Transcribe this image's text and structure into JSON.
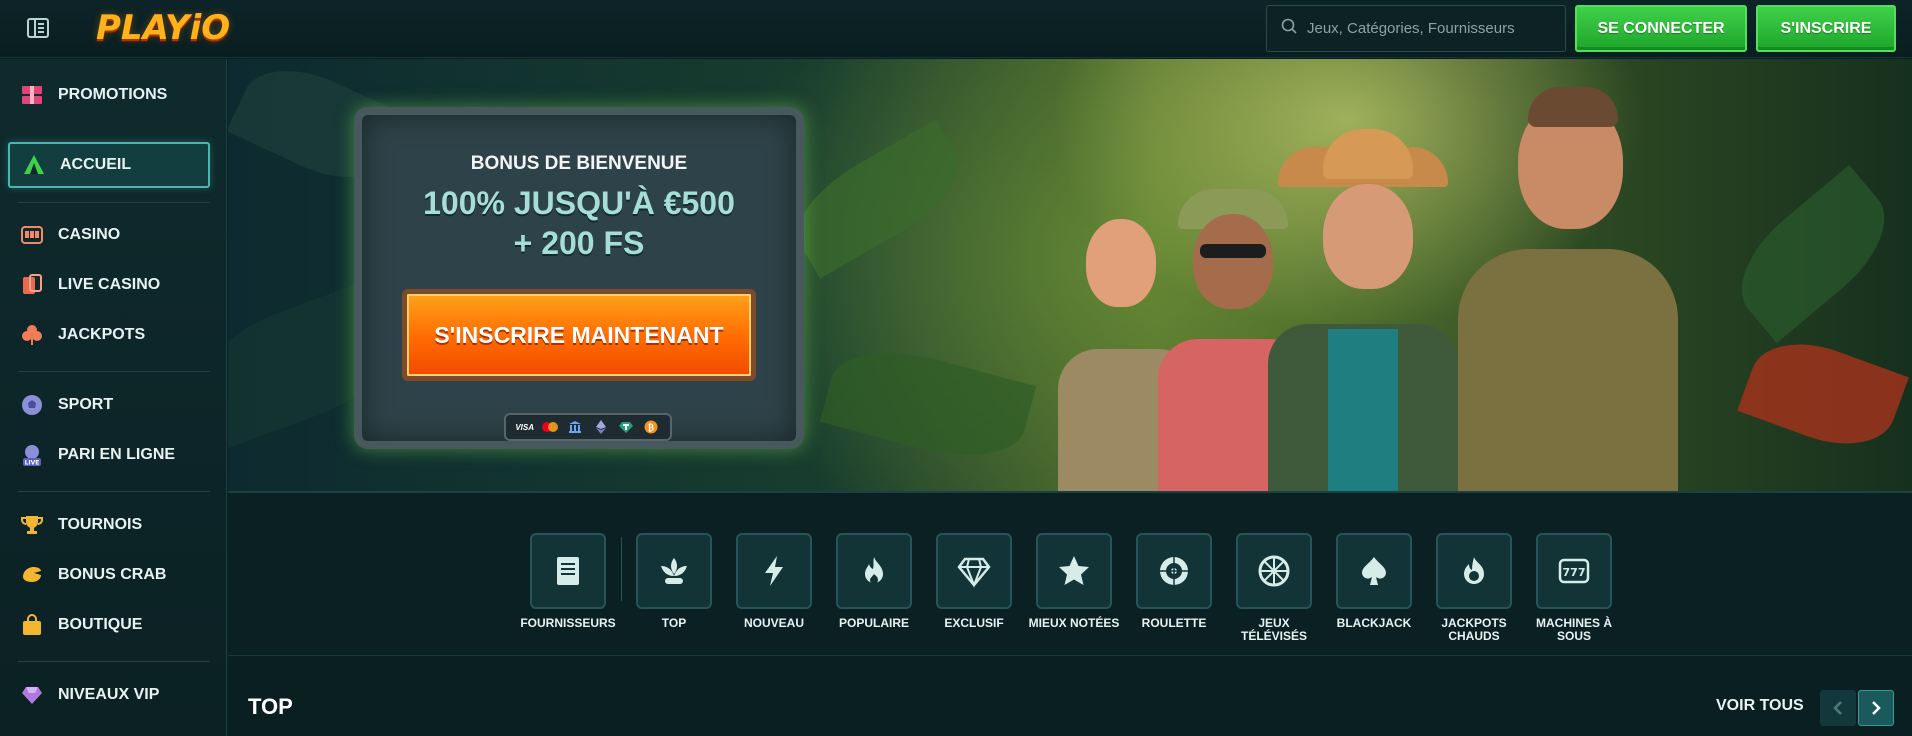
{
  "header": {
    "logo_text": "PLAYiO",
    "search_placeholder": "Jeux, Catégories, Fournisseurs",
    "login_label": "SE CONNECTER",
    "signup_label": "S'INSCRIRE"
  },
  "sidebar": {
    "items": [
      {
        "label": "PROMOTIONS",
        "icon": "gift-icon"
      },
      {
        "label": "ACCUEIL",
        "icon": "tent-icon",
        "active": true
      },
      {
        "label": "CASINO",
        "icon": "slot-machine-icon"
      },
      {
        "label": "LIVE CASINO",
        "icon": "cards-icon"
      },
      {
        "label": "JACKPOTS",
        "icon": "clover-icon"
      },
      {
        "label": "SPORT",
        "icon": "soccer-ball-icon"
      },
      {
        "label": "PARI EN LIGNE",
        "icon": "live-bet-icon"
      },
      {
        "label": "TOURNOIS",
        "icon": "trophy-icon"
      },
      {
        "label": "BONUS CRAB",
        "icon": "crab-claw-icon"
      },
      {
        "label": "BOUTIQUE",
        "icon": "shop-bag-icon"
      },
      {
        "label": "NIVEAUX VIP",
        "icon": "diamond-icon"
      }
    ]
  },
  "hero": {
    "bonus_title": "BONUS DE BIENVENUE",
    "bonus_line1": "100% JUSQU'À €500",
    "bonus_line2": "+ 200 FS",
    "cta_label": "S'INSCRIRE MAINTENANT",
    "payments": [
      "VISA",
      "mastercard",
      "bank",
      "ethereum",
      "tether",
      "bitcoin"
    ]
  },
  "categories": [
    {
      "label": "FOURNISSEURS",
      "icon": "provider-book-icon"
    },
    {
      "label": "TOP",
      "icon": "lotus-icon"
    },
    {
      "label": "NOUVEAU",
      "icon": "lightning-icon"
    },
    {
      "label": "POPULAIRE",
      "icon": "flame-icon"
    },
    {
      "label": "EXCLUSIF",
      "icon": "gem-icon"
    },
    {
      "label": "MIEUX NOTÉES",
      "icon": "star-icon"
    },
    {
      "label": "ROULETTE",
      "icon": "roulette-icon"
    },
    {
      "label": "JEUX TÉLÉVISÉS",
      "icon": "wheel-icon"
    },
    {
      "label": "BLACKJACK",
      "icon": "spade-icon"
    },
    {
      "label": "JACKPOTS CHAUDS",
      "icon": "hot-jackpot-icon"
    },
    {
      "label": "MACHINES À SOUS",
      "icon": "slot-777-icon"
    }
  ],
  "section": {
    "title": "TOP",
    "view_all": "VOIR TOUS"
  },
  "colors": {
    "accent_green": "#2fbf3c",
    "cta_orange": "#ff6a00",
    "teal_border": "#4bb6b0"
  }
}
